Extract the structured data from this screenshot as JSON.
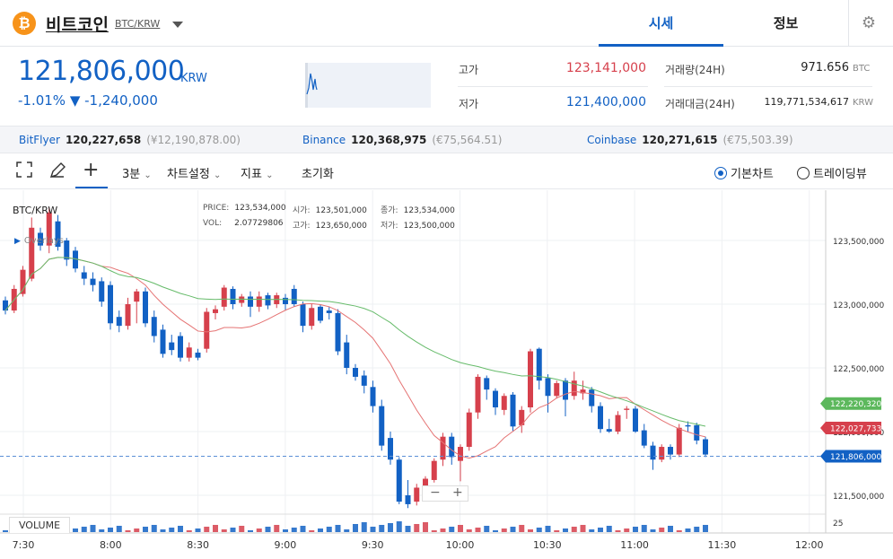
{
  "header": {
    "coin_symbol": "₿",
    "coin_name": "비트코인",
    "pair": "BTC/KRW",
    "tabs": [
      {
        "label": "시세",
        "active": true
      },
      {
        "label": "정보",
        "active": false
      }
    ],
    "accent": "#1261c4"
  },
  "summary": {
    "price": "121,806,000",
    "unit": "KRW",
    "change": "-1.01% ▼ -1,240,000",
    "high_label": "고가",
    "high_value": "123,141,000",
    "low_label": "저가",
    "low_value": "121,400,000",
    "volume_label": "거래량(24H)",
    "volume_value": "971.656",
    "volume_unit": "BTC",
    "amount_label": "거래대금(24H)",
    "amount_value": "119,771,534,617",
    "amount_unit": "KRW",
    "up_color": "#d6404c",
    "down_color": "#1261c4"
  },
  "exchanges": [
    {
      "name": "BitFlyer",
      "price": "120,227,658",
      "fx": "(¥12,190,878.00)"
    },
    {
      "name": "Binance",
      "price": "120,368,975",
      "fx": "(€75,564.51)"
    },
    {
      "name": "Coinbase",
      "price": "120,271,615",
      "fx": "(€75,503.39)"
    }
  ],
  "toolbar": {
    "interval": "3분",
    "chart_settings": "차트설정",
    "indicators": "지표",
    "reset": "초기화",
    "basic_chart": "기본차트",
    "tradingview": "트레이딩뷰"
  },
  "chart": {
    "symbol": "BTC/KRW",
    "overlays": "Overlays",
    "legend": {
      "price_label": "PRICE:",
      "price": "123,534,000",
      "vol_label": "VOL:",
      "vol": "2.07729806",
      "open_label": "시가:",
      "open": "123,501,000",
      "high_label": "고가:",
      "high": "123,650,000",
      "close_label": "종가:",
      "close": "123,534,000",
      "low_label": "저가:",
      "low": "123,500,000"
    },
    "volume_label": "VOLUME",
    "zoom_minus": "−",
    "zoom_plus": "+"
  },
  "chart_data": {
    "type": "candlestick",
    "y_ticks": [
      121500000,
      122000000,
      122500000,
      123000000,
      123500000
    ],
    "y_tick_labels": [
      "121,500,000",
      "122,000,000",
      "122,500,000",
      "123,000,000",
      "123,500,000"
    ],
    "x_tick_labels": [
      "7:30",
      "8:00",
      "8:30",
      "9:00",
      "9:30",
      "10:00",
      "10:30",
      "11:00",
      "11:30",
      "12:00"
    ],
    "volume_tick_label": "25",
    "last_price": 121806000,
    "last_price_label": "121,806,000",
    "ma_long_label": "122,220,320",
    "ma_short_label": "122,027,733",
    "ylim": [
      121350000,
      123700000
    ],
    "candles": [
      [
        123030000,
        122950000,
        123060000,
        122920000
      ],
      [
        122950000,
        123120000,
        123150000,
        122930000
      ],
      [
        123080000,
        123270000,
        123300000,
        123060000
      ],
      [
        123200000,
        123600000,
        123680000,
        123180000
      ],
      [
        123560000,
        123460000,
        123600000,
        123420000
      ],
      [
        123460000,
        123720000,
        123760000,
        123400000
      ],
      [
        123650000,
        123450000,
        123700000,
        123420000
      ],
      [
        123500000,
        123350000,
        123520000,
        123300000
      ],
      [
        123420000,
        123280000,
        123450000,
        123250000
      ],
      [
        123250000,
        123200000,
        123300000,
        123150000
      ],
      [
        123200000,
        123150000,
        123250000,
        123100000
      ],
      [
        123180000,
        123020000,
        123210000,
        122980000
      ],
      [
        123150000,
        122850000,
        123180000,
        122800000
      ],
      [
        122900000,
        122830000,
        122950000,
        122780000
      ],
      [
        122830000,
        123000000,
        123050000,
        122800000
      ],
      [
        123020000,
        123100000,
        123120000,
        122850000
      ],
      [
        123100000,
        122850000,
        123130000,
        122820000
      ],
      [
        122900000,
        122750000,
        122950000,
        122700000
      ],
      [
        122800000,
        122610000,
        122840000,
        122580000
      ],
      [
        122700000,
        122640000,
        122760000,
        122600000
      ],
      [
        122750000,
        122580000,
        122780000,
        122550000
      ],
      [
        122580000,
        122660000,
        122700000,
        122550000
      ],
      [
        122620000,
        122580000,
        122650000,
        122560000
      ],
      [
        122650000,
        122940000,
        122970000,
        122620000
      ],
      [
        122930000,
        122960000,
        122990000,
        122880000
      ],
      [
        122980000,
        123130000,
        123150000,
        122950000
      ],
      [
        123120000,
        123000000,
        123140000,
        122960000
      ],
      [
        123010000,
        123060000,
        123080000,
        122980000
      ],
      [
        123060000,
        122980000,
        123100000,
        122900000
      ],
      [
        122980000,
        123060000,
        123100000,
        122940000
      ],
      [
        123070000,
        122990000,
        123090000,
        122960000
      ],
      [
        123000000,
        123070000,
        123090000,
        122970000
      ],
      [
        123050000,
        123000000,
        123080000,
        122950000
      ],
      [
        123120000,
        123000000,
        123150000,
        122980000
      ],
      [
        123000000,
        122830000,
        123020000,
        122780000
      ],
      [
        122830000,
        122970000,
        123000000,
        122800000
      ],
      [
        122980000,
        122870000,
        123000000,
        122850000
      ],
      [
        122950000,
        122930000,
        122980000,
        122880000
      ],
      [
        122930000,
        122630000,
        122960000,
        122600000
      ],
      [
        122700000,
        122500000,
        122760000,
        122450000
      ],
      [
        122500000,
        122430000,
        122530000,
        122400000
      ],
      [
        122440000,
        122360000,
        122480000,
        122300000
      ],
      [
        122350000,
        122200000,
        122400000,
        122150000
      ],
      [
        122200000,
        121890000,
        122250000,
        121850000
      ],
      [
        121950000,
        121780000,
        122000000,
        121740000
      ],
      [
        121780000,
        121450000,
        121800000,
        121430000
      ],
      [
        121500000,
        121430000,
        121620000,
        121400000
      ],
      [
        121450000,
        121560000,
        121590000,
        121420000
      ],
      [
        121560000,
        121630000,
        121650000,
        121520000
      ],
      [
        121620000,
        121770000,
        121790000,
        121600000
      ],
      [
        121780000,
        121960000,
        121990000,
        121730000
      ],
      [
        121960000,
        121800000,
        121990000,
        121740000
      ],
      [
        121770000,
        121880000,
        121900000,
        121610000
      ],
      [
        121880000,
        122150000,
        122180000,
        121850000
      ],
      [
        122150000,
        122430000,
        122450000,
        122100000
      ],
      [
        122420000,
        122330000,
        122440000,
        122250000
      ],
      [
        122320000,
        122190000,
        122340000,
        122130000
      ],
      [
        122170000,
        122280000,
        122300000,
        122130000
      ],
      [
        122290000,
        122040000,
        122310000,
        122000000
      ],
      [
        122050000,
        122170000,
        122200000,
        121990000
      ],
      [
        122190000,
        122630000,
        122650000,
        122150000
      ],
      [
        122650000,
        122400000,
        122660000,
        122330000
      ],
      [
        122420000,
        122280000,
        122450000,
        122150000
      ],
      [
        122280000,
        122380000,
        122400000,
        122260000
      ],
      [
        122400000,
        122250000,
        122420000,
        122120000
      ],
      [
        122280000,
        122400000,
        122470000,
        122250000
      ],
      [
        122300000,
        122330000,
        122400000,
        122250000
      ],
      [
        122330000,
        122200000,
        122350000,
        122150000
      ],
      [
        122200000,
        122020000,
        122230000,
        121990000
      ],
      [
        122020000,
        122000000,
        122100000,
        121990000
      ],
      [
        122000000,
        122130000,
        122160000,
        121980000
      ],
      [
        122170000,
        122180000,
        122200000,
        122100000
      ],
      [
        122180000,
        122000000,
        122200000,
        121990000
      ],
      [
        122010000,
        121890000,
        122060000,
        121870000
      ],
      [
        121890000,
        121780000,
        121920000,
        121700000
      ],
      [
        121780000,
        121880000,
        121900000,
        121760000
      ],
      [
        121880000,
        121820000,
        121900000,
        121780000
      ],
      [
        121820000,
        122030000,
        122060000,
        121800000
      ],
      [
        122050000,
        122040000,
        122080000,
        122000000
      ],
      [
        122050000,
        121930000,
        122070000,
        121900000
      ],
      [
        121940000,
        121820000,
        121960000,
        121800000
      ]
    ]
  }
}
